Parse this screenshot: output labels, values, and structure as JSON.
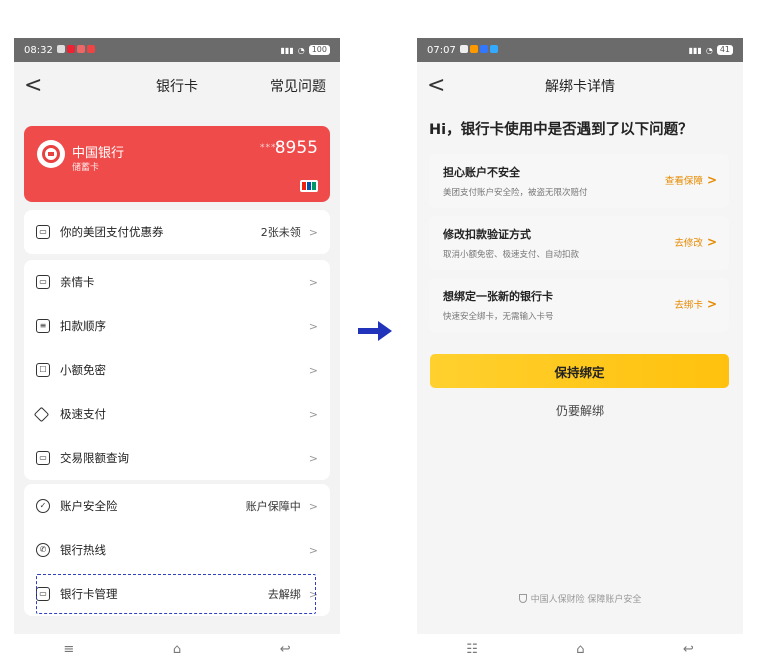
{
  "left": {
    "status": {
      "time": "08:32",
      "battery": "100"
    },
    "nav": {
      "back": "<",
      "title": "银行卡",
      "help": "常见问题"
    },
    "card": {
      "bank": "中国银行",
      "type": "储蓄卡",
      "mask": "****",
      "last4": "8955"
    },
    "coupon": {
      "label": "你的美团支付优惠券",
      "value": "2张未领",
      "chev": ">"
    },
    "menu1": [
      {
        "label": "亲情卡",
        "chev": ">"
      },
      {
        "label": "扣款顺序",
        "chev": ">"
      },
      {
        "label": "小额免密",
        "chev": ">"
      },
      {
        "label": "极速支付",
        "chev": ">"
      },
      {
        "label": "交易限额查询",
        "chev": ">"
      }
    ],
    "menu2": [
      {
        "label": "账户安全险",
        "value": "账户保障中",
        "chev": ">"
      },
      {
        "label": "银行热线",
        "value": "",
        "chev": ">"
      },
      {
        "label": "银行卡管理",
        "value": "去解绑",
        "chev": ">"
      }
    ],
    "sysnav": [
      "≡",
      "⌂",
      "↩"
    ]
  },
  "right": {
    "status": {
      "time": "07:07",
      "battery": "41"
    },
    "nav": {
      "back": "<",
      "title": "解绑卡详情"
    },
    "heading": "Hi，银行卡使用中是否遇到了以下问题？",
    "options": [
      {
        "title": "担心账户不安全",
        "sub": "美团支付账户安全险，被盗无限次赔付",
        "link": "查看保障"
      },
      {
        "title": "修改扣款验证方式",
        "sub": "取消小额免密、极速支付、自动扣款",
        "link": "去修改"
      },
      {
        "title": "想绑定一张新的银行卡",
        "sub": "快速安全绑卡，无需输入卡号",
        "link": "去绑卡"
      }
    ],
    "keep_button": "保持绑定",
    "unbind_link": "仍要解绑",
    "footer": "中国人保财险 保障账户安全",
    "sysnav": [
      "☷",
      "⌂",
      "↩"
    ]
  },
  "colors": {
    "card_red": "#f04b4b",
    "button_yellow": "#ffc10d",
    "link_orange": "#e68a00",
    "arrow_blue": "#2233bb"
  }
}
